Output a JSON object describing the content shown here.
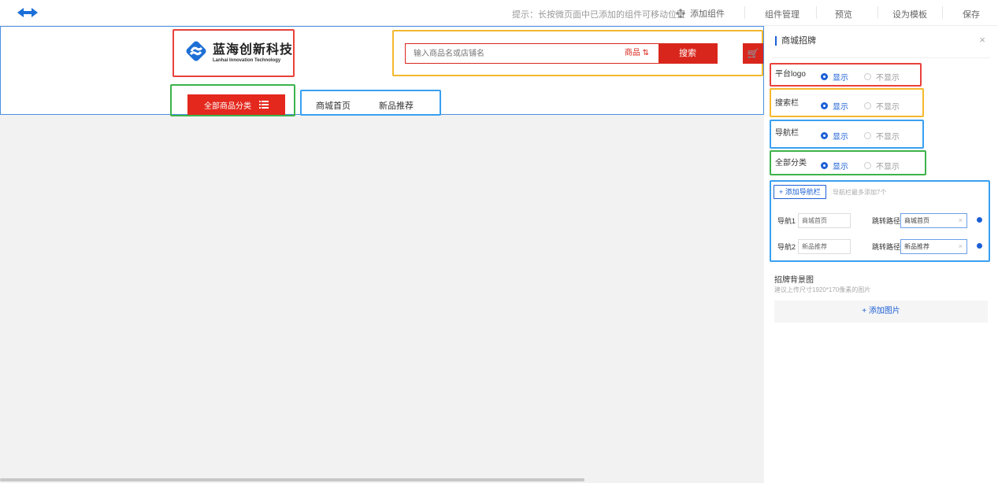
{
  "topbar": {
    "hint": "提示：长按微页面中已添加的组件可移动位置",
    "add_component": "添加组件",
    "component_manage": "组件管理",
    "preview": "预览",
    "set_template": "设为模板",
    "save": "保存"
  },
  "sign": {
    "brand_name": "蓝海创新科技",
    "brand_en": "Lanhai Innovation Technology",
    "search_placeholder": "输入商品名或店铺名",
    "search_type": "商品",
    "search_button": "搜索",
    "all_categories": "全部商品分类",
    "nav": [
      "商城首页",
      "新品推荐"
    ]
  },
  "panel": {
    "title": "商城招牌",
    "options": [
      {
        "label": "平台logo",
        "on": "显示",
        "off": "不显示"
      },
      {
        "label": "搜索栏",
        "on": "显示",
        "off": "不显示"
      },
      {
        "label": "导航栏",
        "on": "显示",
        "off": "不显示"
      },
      {
        "label": "全部分类",
        "on": "显示",
        "off": "不显示"
      }
    ],
    "add_nav_button": "添加导航栏",
    "add_nav_tip": "导航栏最多添加7个",
    "nav_rows": [
      {
        "label": "导航1",
        "name": "商城首页",
        "path_label": "跳转路径",
        "path": "商城首页"
      },
      {
        "label": "导航2",
        "name": "新品推荐",
        "path_label": "跳转路径",
        "path": "新品推荐"
      }
    ],
    "bg_title": "招牌背景图",
    "bg_tip": "建议上传尺寸1920*170像素的图片",
    "add_image": "添加图片"
  },
  "colors": {
    "brand_red": "#e4281d",
    "accent_blue": "#1b5fd6",
    "outline_red": "#e8413b",
    "outline_yellow": "#f5b82e",
    "outline_green": "#3cb34a",
    "outline_blue": "#39a0f0"
  }
}
